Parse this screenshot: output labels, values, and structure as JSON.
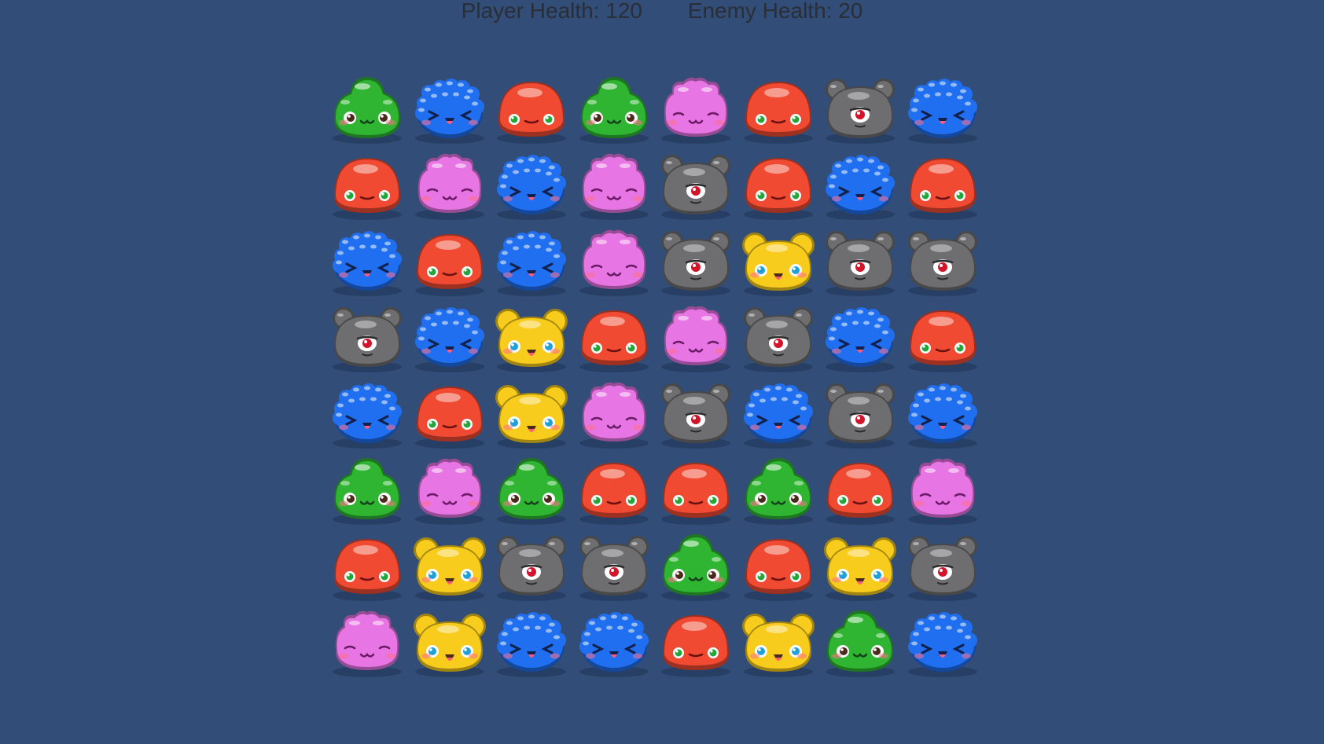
{
  "hud": {
    "player_health_label": "Player Health: 120",
    "enemy_health_label": "Enemy Health: 20"
  },
  "colors": {
    "background": "#324d77",
    "hud_text": "#2a2e36",
    "green": "#2fb531",
    "blue": "#1f6ff0",
    "red": "#f04a32",
    "pink": "#e775e3",
    "gray": "#6e6e70",
    "yellow": "#f7cc1c"
  },
  "board": {
    "rows": 8,
    "cols": 8,
    "grid": [
      [
        "green",
        "blue",
        "red",
        "green",
        "pink",
        "red",
        "gray",
        "blue"
      ],
      [
        "red",
        "pink",
        "blue",
        "pink",
        "gray",
        "red",
        "blue",
        "red"
      ],
      [
        "blue",
        "red",
        "blue",
        "pink",
        "gray",
        "yellow",
        "gray",
        "gray"
      ],
      [
        "gray",
        "blue",
        "yellow",
        "red",
        "pink",
        "gray",
        "blue",
        "red"
      ],
      [
        "blue",
        "red",
        "yellow",
        "pink",
        "gray",
        "blue",
        "gray",
        "blue"
      ],
      [
        "green",
        "pink",
        "green",
        "red",
        "red",
        "green",
        "red",
        "pink"
      ],
      [
        "red",
        "yellow",
        "gray",
        "gray",
        "green",
        "red",
        "yellow",
        "gray"
      ],
      [
        "pink",
        "yellow",
        "blue",
        "blue",
        "red",
        "yellow",
        "green",
        "blue"
      ]
    ]
  }
}
